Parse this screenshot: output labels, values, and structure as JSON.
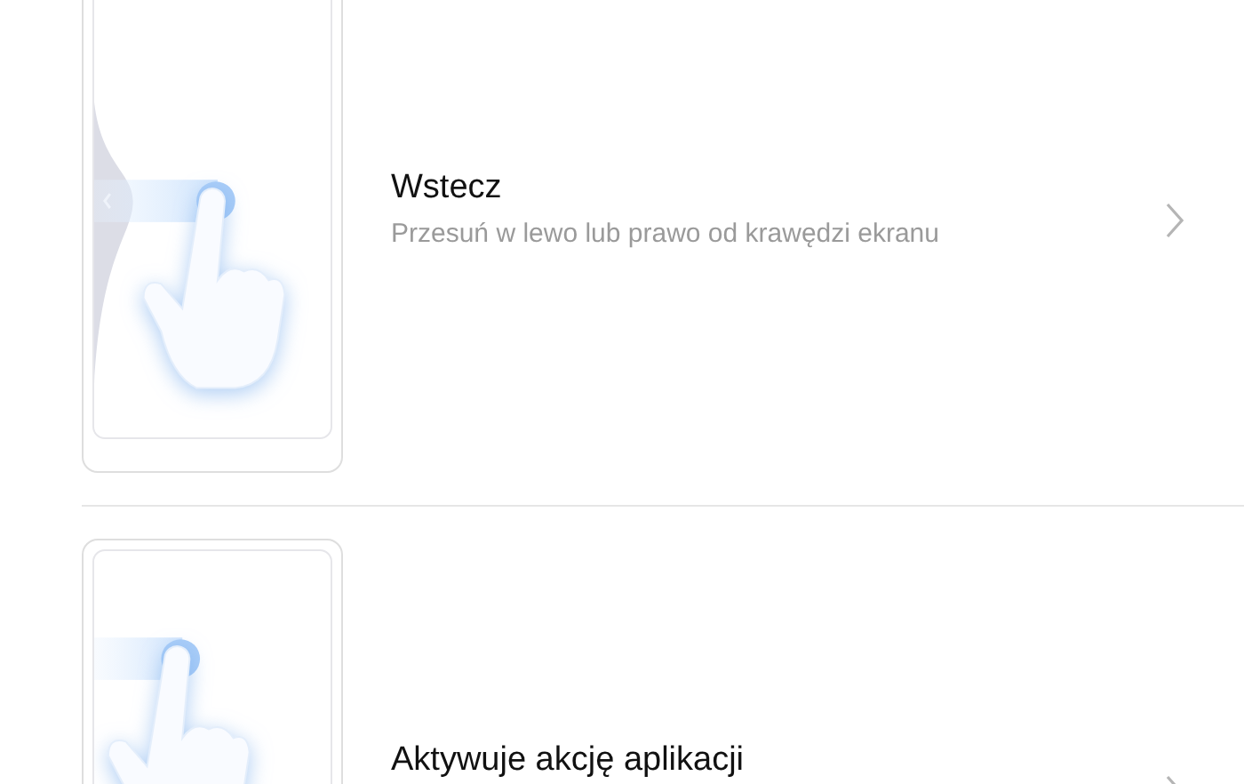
{
  "gestures": [
    {
      "kind": "back",
      "title": "Wstecz",
      "subtitle": "Przesuń w lewo lub prawo od krawędzi ekranu"
    },
    {
      "kind": "app-action",
      "title": "Aktywuje akcję aplikacji"
    }
  ]
}
